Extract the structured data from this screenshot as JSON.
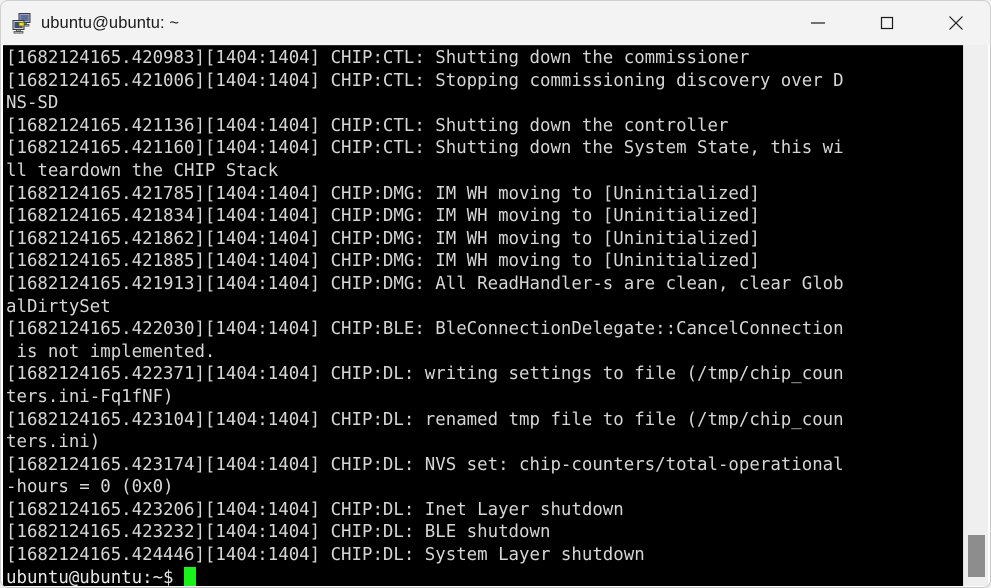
{
  "window": {
    "title": "ubuntu@ubuntu: ~",
    "icon": "putty-terminal-icon",
    "controls": {
      "minimize": "minimize-icon",
      "maximize": "maximize-icon",
      "close": "close-icon"
    }
  },
  "terminal": {
    "background_color": "#000000",
    "foreground_color": "#d6d6d6",
    "cursor_color": "#18f218",
    "lines": [
      "[1682124165.420983][1404:1404] CHIP:CTL: Shutting down the commissioner",
      "[1682124165.421006][1404:1404] CHIP:CTL: Stopping commissioning discovery over D",
      "NS-SD",
      "[1682124165.421136][1404:1404] CHIP:CTL: Shutting down the controller",
      "[1682124165.421160][1404:1404] CHIP:CTL: Shutting down the System State, this wi",
      "ll teardown the CHIP Stack",
      "[1682124165.421785][1404:1404] CHIP:DMG: IM WH moving to [Uninitialized]",
      "[1682124165.421834][1404:1404] CHIP:DMG: IM WH moving to [Uninitialized]",
      "[1682124165.421862][1404:1404] CHIP:DMG: IM WH moving to [Uninitialized]",
      "[1682124165.421885][1404:1404] CHIP:DMG: IM WH moving to [Uninitialized]",
      "[1682124165.421913][1404:1404] CHIP:DMG: All ReadHandler-s are clean, clear Glob",
      "alDirtySet",
      "[1682124165.422030][1404:1404] CHIP:BLE: BleConnectionDelegate::CancelConnection",
      " is not implemented.",
      "[1682124165.422371][1404:1404] CHIP:DL: writing settings to file (/tmp/chip_coun",
      "ters.ini-Fq1fNF)",
      "[1682124165.423104][1404:1404] CHIP:DL: renamed tmp file to file (/tmp/chip_coun",
      "ters.ini)",
      "[1682124165.423174][1404:1404] CHIP:DL: NVS set: chip-counters/total-operational",
      "-hours = 0 (0x0)",
      "[1682124165.423206][1404:1404] CHIP:DL: Inet Layer shutdown",
      "[1682124165.423232][1404:1404] CHIP:DL: BLE shutdown",
      "[1682124165.424446][1404:1404] CHIP:DL: System Layer shutdown"
    ],
    "prompt": "ubuntu@ubuntu:~$ ",
    "command_input": ""
  },
  "scrollbar": {
    "name": "vertical-scrollbar",
    "thumb_name": "scrollbar-thumb"
  }
}
